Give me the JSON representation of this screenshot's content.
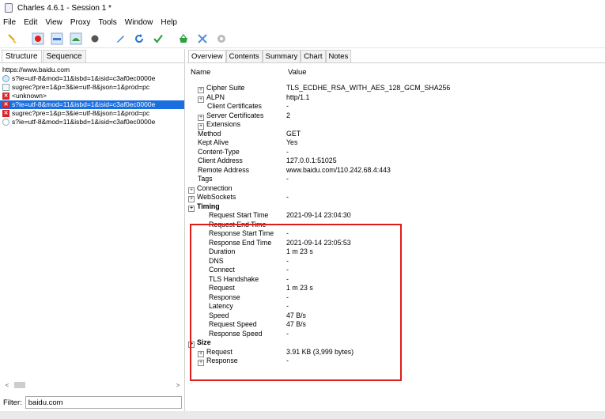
{
  "window": {
    "title": "Charles 4.6.1 - Session 1 *"
  },
  "menu": [
    "File",
    "Edit",
    "View",
    "Proxy",
    "Tools",
    "Window",
    "Help"
  ],
  "toolbar": {
    "icons": [
      "broom-icon",
      "record-icon",
      "throttle-icon",
      "turtle-icon",
      "breakpoint-icon",
      "pen-icon",
      "refresh-icon",
      "check-icon",
      "basket-icon",
      "tools-icon",
      "settings-icon"
    ]
  },
  "left": {
    "tabs": [
      "Structure",
      "Sequence"
    ],
    "tree": [
      {
        "text": "https://www.baidu.com",
        "icon": "",
        "selected": false
      },
      {
        "text": "s?ie=utf-8&mod=11&isbd=1&isid=c3af0ec0000e",
        "icon": "ok",
        "selected": false
      },
      {
        "text": "sugrec?pre=1&p=3&ie=utf-8&json=1&prod=pc",
        "icon": "doc",
        "selected": false
      },
      {
        "text": "<unknown>",
        "icon": "err",
        "selected": false
      },
      {
        "text": "s?ie=utf-8&mod=11&isbd=1&isid=c3af0ec0000e",
        "icon": "err",
        "selected": true
      },
      {
        "text": "sugrec?pre=1&p=3&ie=utf-8&json=1&prod=pc",
        "icon": "err",
        "selected": false
      },
      {
        "text": "s?ie=utf-8&mod=11&isbd=1&isid=c3af0ec0000e",
        "icon": "wait",
        "selected": false
      }
    ],
    "filter": {
      "label": "Filter:",
      "value": "baidu.com"
    }
  },
  "right": {
    "tabs": [
      "Overview",
      "Contents",
      "Summary",
      "Chart",
      "Notes"
    ],
    "header": {
      "name": "Name",
      "value": "Value"
    },
    "rows": [
      {
        "name": "Cipher Suite",
        "value": "TLS_ECDHE_RSA_WITH_AES_128_GCM_SHA256",
        "level": 1,
        "exp": true
      },
      {
        "name": "ALPN",
        "value": "http/1.1",
        "level": 1,
        "exp": true
      },
      {
        "name": "Client Certificates",
        "value": "-",
        "level": 1,
        "exp": false
      },
      {
        "name": "Server Certificates",
        "value": "2",
        "level": 1,
        "exp": true
      },
      {
        "name": "Extensions",
        "value": "",
        "level": 1,
        "exp": true
      },
      {
        "name": "Method",
        "value": "GET",
        "level": 0,
        "exp": false
      },
      {
        "name": "Kept Alive",
        "value": "Yes",
        "level": 0,
        "exp": false
      },
      {
        "name": "Content-Type",
        "value": "-",
        "level": 0,
        "exp": false
      },
      {
        "name": "Client Address",
        "value": "127.0.0.1:51025",
        "level": 0,
        "exp": false
      },
      {
        "name": "Remote Address",
        "value": "www.baidu.com/110.242.68.4:443",
        "level": 0,
        "exp": false
      },
      {
        "name": "Tags",
        "value": "-",
        "level": 0,
        "exp": false
      },
      {
        "name": "Connection",
        "value": "",
        "level": -1,
        "exp": true
      },
      {
        "name": "WebSockets",
        "value": "-",
        "level": -1,
        "exp": true
      },
      {
        "name": "Timing",
        "value": "",
        "level": -1,
        "exp": true,
        "bold": true
      },
      {
        "name": "Request Start Time",
        "value": "2021-09-14 23:04:30",
        "level": 2,
        "exp": false
      },
      {
        "name": "Request End Time",
        "value": "-",
        "level": 2,
        "exp": false
      },
      {
        "name": "Response Start Time",
        "value": "-",
        "level": 2,
        "exp": false
      },
      {
        "name": "Response End Time",
        "value": "2021-09-14 23:05:53",
        "level": 2,
        "exp": false
      },
      {
        "name": "Duration",
        "value": "1 m 23 s",
        "level": 2,
        "exp": false
      },
      {
        "name": "DNS",
        "value": "-",
        "level": 2,
        "exp": false
      },
      {
        "name": "Connect",
        "value": "-",
        "level": 2,
        "exp": false
      },
      {
        "name": "TLS Handshake",
        "value": "-",
        "level": 2,
        "exp": false
      },
      {
        "name": "Request",
        "value": "1 m 23 s",
        "level": 2,
        "exp": false
      },
      {
        "name": "Response",
        "value": "-",
        "level": 2,
        "exp": false
      },
      {
        "name": "Latency",
        "value": "-",
        "level": 2,
        "exp": false
      },
      {
        "name": "Speed",
        "value": "47 B/s",
        "level": 2,
        "exp": false
      },
      {
        "name": "Request Speed",
        "value": "47 B/s",
        "level": 2,
        "exp": false
      },
      {
        "name": "Response Speed",
        "value": "-",
        "level": 2,
        "exp": false
      },
      {
        "name": "Size",
        "value": "",
        "level": -1,
        "exp": true,
        "bold": true
      },
      {
        "name": "Request",
        "value": "3.91 KB (3,999 bytes)",
        "level": 1,
        "exp": true
      },
      {
        "name": "Response",
        "value": "-",
        "level": 1,
        "exp": true
      }
    ]
  },
  "colors": {
    "selection": "#1a6fe0",
    "highlight_box": "#e01b1b",
    "error": "#d9232a"
  }
}
